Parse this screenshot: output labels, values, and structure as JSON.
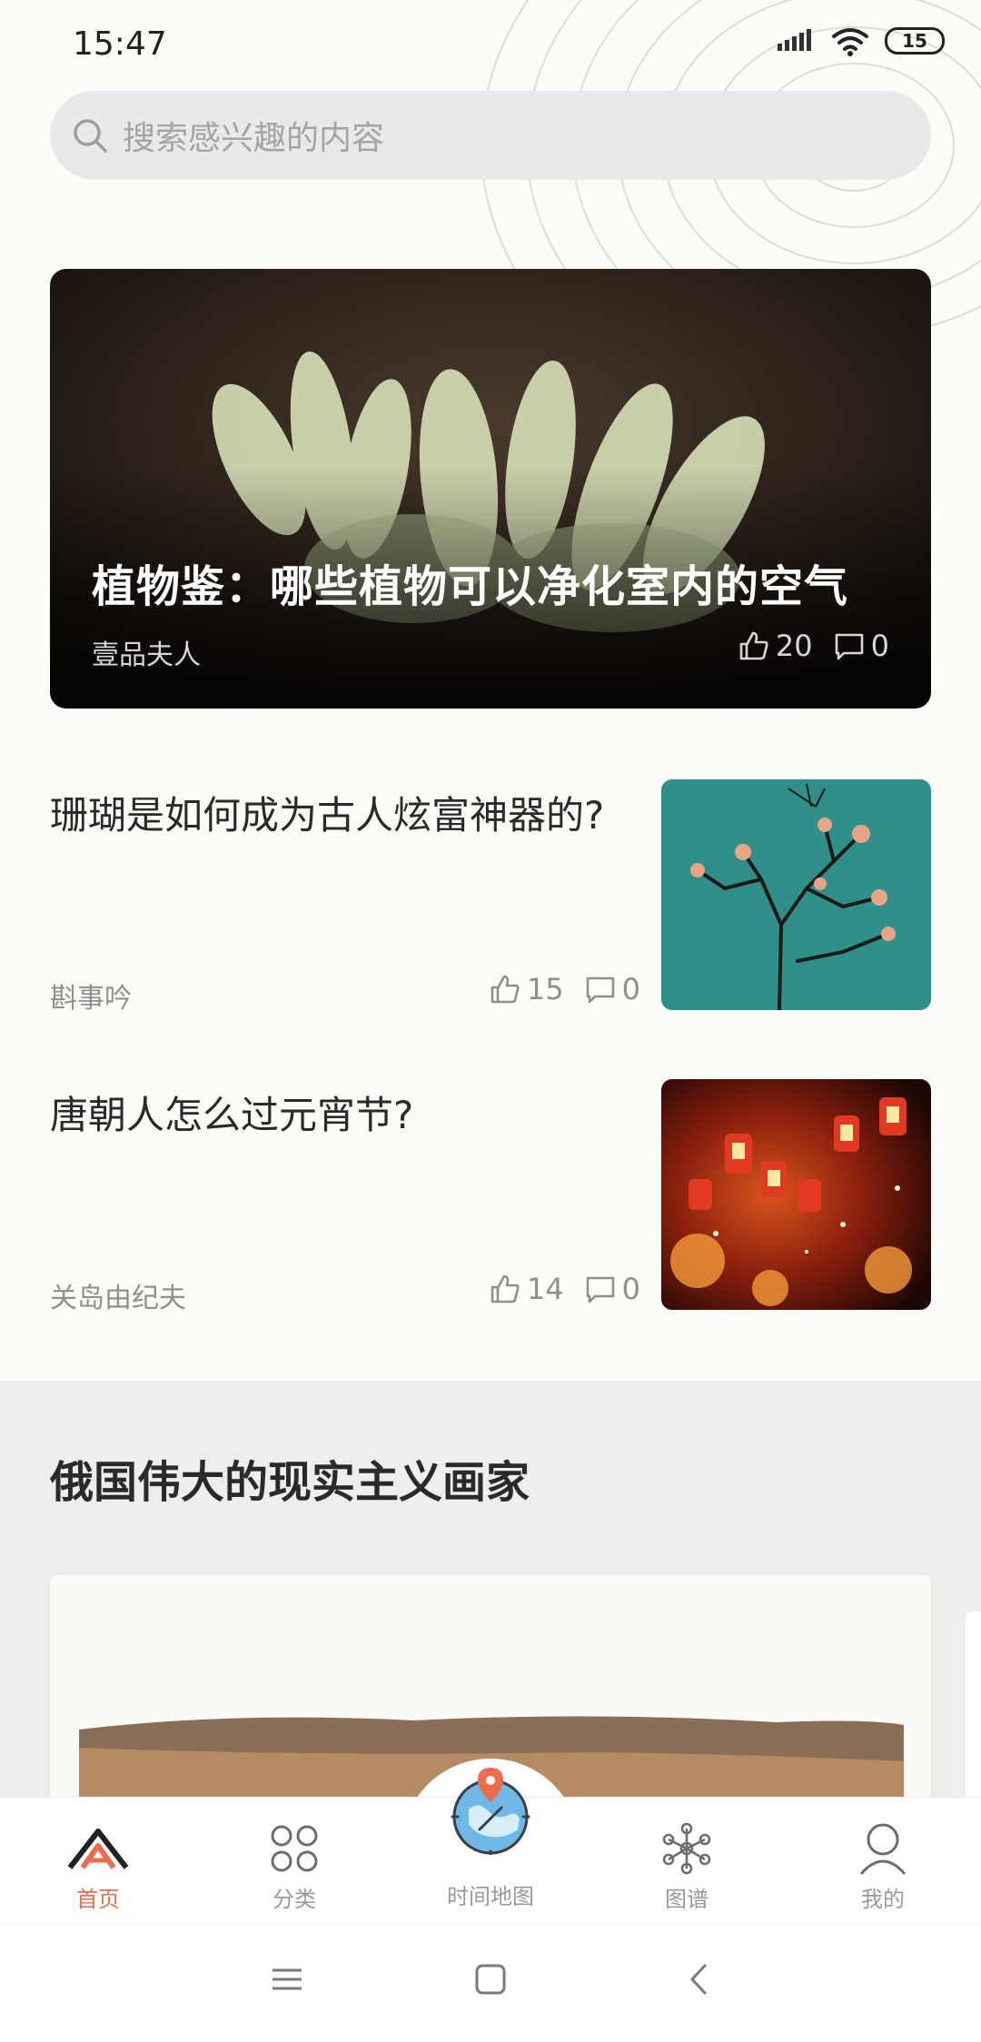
{
  "status_bar": {
    "time": "15:47",
    "battery": "15"
  },
  "search": {
    "placeholder": "搜索感兴趣的内容"
  },
  "hero": {
    "title": "植物鉴：哪些植物可以净化室内的空气",
    "author": "壹品夫人",
    "likes": "20",
    "comments": "0"
  },
  "articles": [
    {
      "title": "珊瑚是如何成为古人炫富神器的?",
      "author": "斟事吟",
      "likes": "15",
      "comments": "0"
    },
    {
      "title": "唐朝人怎么过元宵节?",
      "author": "关岛由纪夫",
      "likes": "14",
      "comments": "0"
    }
  ],
  "section": {
    "title": "俄国伟大的现实主义画家"
  },
  "bottom_nav": {
    "items": [
      {
        "label": "首页",
        "icon": "home-logo-icon",
        "active": true
      },
      {
        "label": "分类",
        "icon": "grid-circles-icon"
      },
      {
        "label": "时间地图",
        "icon": "globe-pin-icon"
      },
      {
        "label": "图谱",
        "icon": "graph-nodes-icon"
      },
      {
        "label": "我的",
        "icon": "user-icon"
      }
    ]
  },
  "colors": {
    "accent": "#ef6b4e",
    "search_bg": "#e8e9ea",
    "text_gray": "#8f8f8f"
  }
}
